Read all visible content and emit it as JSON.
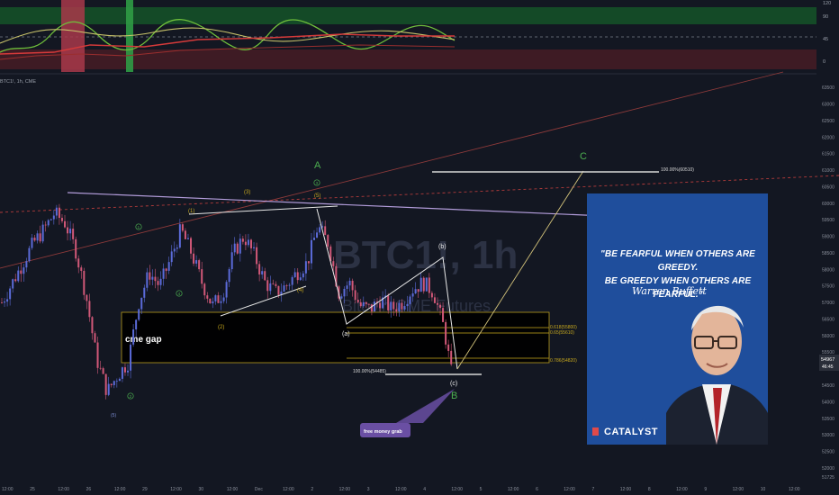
{
  "watermark": {
    "symbol": "BTC1!, 1h",
    "subtitle": "Bitcoin CME Futures"
  },
  "indicator": {
    "label": "BTC1!, 1h, CME",
    "axis_ticks": [
      "120",
      "90",
      "45",
      "0"
    ]
  },
  "price_axis": {
    "ticks": [
      "63500",
      "63000",
      "62500",
      "62000",
      "61500",
      "61000",
      "60500",
      "60000",
      "59500",
      "59000",
      "58500",
      "58000",
      "57500",
      "57000",
      "56500",
      "56000",
      "55500",
      "55000",
      "54500",
      "54000",
      "53500",
      "53000",
      "52500",
      "52000",
      "51725"
    ],
    "current_price": "54967",
    "countdown": "46:45"
  },
  "time_axis": {
    "ticks": [
      "12:00",
      "25",
      "12:00",
      "26",
      "12:00",
      "29",
      "12:00",
      "30",
      "12:00",
      "Dec",
      "12:00",
      "2",
      "12:00",
      "3",
      "12:00",
      "4",
      "12:00",
      "5",
      "12:00",
      "6",
      "12:00",
      "7",
      "12:00",
      "8",
      "12:00",
      "9",
      "12:00",
      "10",
      "12:00"
    ]
  },
  "annotations": {
    "cme_gap": "cme gap",
    "free_money": "free money grab",
    "wave_A": "A",
    "wave_B": "B",
    "wave_C": "C",
    "sub_a": "(a)",
    "sub_b": "(b)",
    "sub_c": "(c)",
    "fib_618": "0.618(55800)",
    "fib_65": "0.65(55610)",
    "fib_786": "0.786(54820)",
    "fib_100": "100.00%(54485)",
    "fib_100c": "100.00%(60510)",
    "impulse_labels": [
      "(1)",
      "(2)",
      "(3)",
      "(4)",
      "(5)"
    ],
    "circle_labels": [
      "1",
      "2",
      "3",
      "4",
      "5"
    ],
    "wave_low": "(5)"
  },
  "quote_card": {
    "line1": "\"BE FEARFUL WHEN OTHERS ARE GREEDY.",
    "line2": "BE GREEDY WHEN OTHERS ARE FEARFUL.\"",
    "author": "Warren Buffett",
    "brand": "CATALYST"
  },
  "colors": {
    "bg": "#131722",
    "up": "#5b6bd9",
    "down": "#d15878",
    "gap_box": "#c8a91e",
    "wave_label": "#4caf50",
    "trendline": "#b39ddb",
    "target_line": "#d8d8d8",
    "dotted_red": "#b23b3b",
    "projection": "#d2c27a",
    "card": "#1f4e9c"
  },
  "chart_data": {
    "type": "candlestick",
    "title": "BTC1!, 1h",
    "ylim": [
      51725,
      63750
    ],
    "candles_path": [
      [
        0,
        57000
      ],
      [
        0.3,
        57600
      ],
      [
        0.6,
        58200
      ],
      [
        0.9,
        58800
      ],
      [
        1.2,
        59200
      ],
      [
        1.5,
        59700
      ],
      [
        1.8,
        59400
      ],
      [
        2.1,
        58600
      ],
      [
        2.4,
        57200
      ],
      [
        2.7,
        55300
      ],
      [
        3.0,
        54300
      ],
      [
        3.3,
        54800
      ],
      [
        3.6,
        55200
      ],
      [
        3.9,
        57000
      ],
      [
        4.2,
        57900
      ],
      [
        4.5,
        57500
      ],
      [
        4.8,
        58300
      ],
      [
        5.1,
        59200
      ],
      [
        5.4,
        58500
      ],
      [
        5.7,
        57600
      ],
      [
        6.0,
        56900
      ],
      [
        6.3,
        57300
      ],
      [
        6.6,
        58500
      ],
      [
        6.9,
        59000
      ],
      [
        7.2,
        58400
      ],
      [
        7.5,
        57600
      ],
      [
        7.8,
        57300
      ],
      [
        8.1,
        57500
      ],
      [
        8.4,
        57900
      ],
      [
        8.7,
        58200
      ],
      [
        9.0,
        59300
      ],
      [
        9.3,
        58800
      ],
      [
        9.6,
        57300
      ],
      [
        9.9,
        57600
      ],
      [
        10.2,
        56900
      ],
      [
        10.5,
        56800
      ],
      [
        10.8,
        57100
      ],
      [
        11.1,
        56800
      ],
      [
        11.4,
        57000
      ],
      [
        11.7,
        57400
      ],
      [
        12.0,
        57600
      ],
      [
        12.3,
        57300
      ],
      [
        12.6,
        56200
      ],
      [
        12.8,
        54900
      ]
    ]
  }
}
